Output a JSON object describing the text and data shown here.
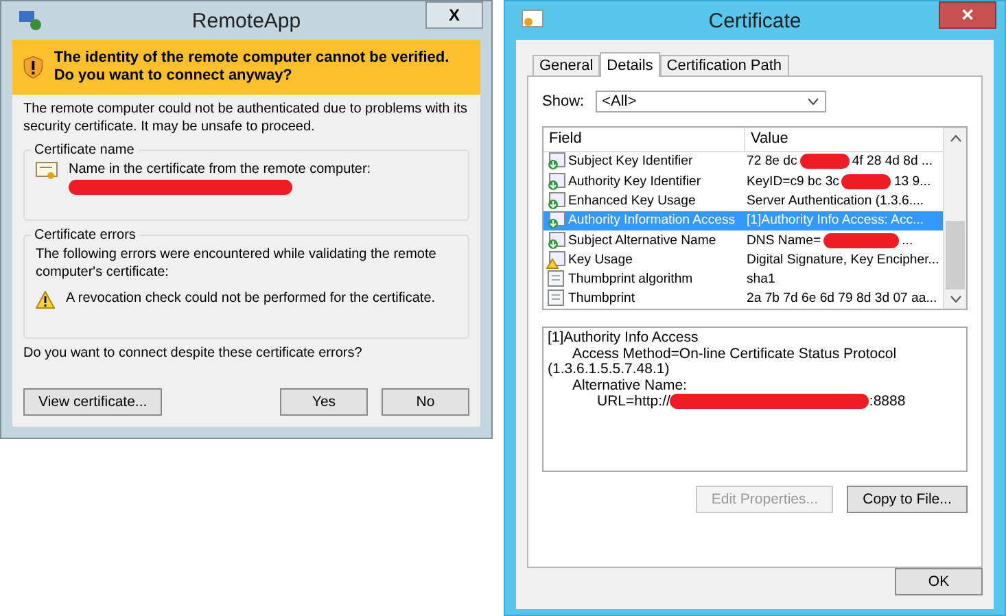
{
  "remoteapp": {
    "title": "RemoteApp",
    "close": "X",
    "warning": "The identity of the remote computer cannot be verified. Do you want to connect anyway?",
    "intro": "The remote computer could not be authenticated due to problems with its security certificate. It may be unsafe to proceed.",
    "cert_name_group": {
      "legend": "Certificate name",
      "label": "Name in the certificate from the remote computer:"
    },
    "cert_errors_group": {
      "legend": "Certificate errors",
      "text": "The following errors were encountered while validating the remote computer's certificate:",
      "errors": [
        "A revocation check could not be performed for the certificate."
      ]
    },
    "question": "Do you want to connect despite these certificate errors?",
    "buttons": [
      {
        "label": "View certificate...",
        "kind": "left"
      },
      {
        "label": "Yes",
        "kind": "right"
      },
      {
        "label": "No",
        "kind": "right"
      }
    ]
  },
  "certificate": {
    "title": "Certificate",
    "close": "✕",
    "tabs": [
      {
        "label": "General",
        "selected": false
      },
      {
        "label": "Details",
        "selected": true
      },
      {
        "label": "Certification Path",
        "selected": false
      }
    ],
    "show": {
      "label": "Show:",
      "value": "<All>"
    },
    "columns": [
      "Field",
      "Value"
    ],
    "rows": [
      {
        "field": "Subject Key Identifier",
        "value_parts": [
          "72 8e dc",
          "4f 28 4d 8d ..."
        ],
        "kind": "extension",
        "selected": false
      },
      {
        "field": "Authority Key Identifier",
        "value_parts": [
          "KeyID=c9 bc 3c",
          "13 9..."
        ],
        "kind": "extension",
        "selected": false
      },
      {
        "field": "Enhanced Key Usage",
        "value_parts": [
          "Server Authentication (1.3.6...."
        ],
        "kind": "extension",
        "selected": false
      },
      {
        "field": "Authority Information Access",
        "value_parts": [
          "[1]Authority Info Access: Acc..."
        ],
        "kind": "extension",
        "selected": true
      },
      {
        "field": "Subject Alternative Name",
        "value_parts": [
          "DNS Name=",
          "..."
        ],
        "kind": "extension",
        "selected": false
      },
      {
        "field": "Key Usage",
        "value_parts": [
          "Digital Signature, Key Encipher..."
        ],
        "kind": "critical",
        "selected": false
      },
      {
        "field": "Thumbprint algorithm",
        "value_parts": [
          "sha1"
        ],
        "kind": "property",
        "selected": false
      },
      {
        "field": "Thumbprint",
        "value_parts": [
          "2a 7b 7d 6e 6d 79 8d 3d 07 aa..."
        ],
        "kind": "property",
        "selected": false
      }
    ],
    "detail_lines": [
      {
        "parts": [
          "[1]Authority Info Access"
        ],
        "children": [
          {
            "parts": [
              "Access Method=On-line Certificate Status Protocol (1.3.6.1.5.5.7.48.1)"
            ]
          },
          {
            "parts": [
              "Alternative Name:"
            ],
            "children": [
              {
                "parts": [
                  "URL=http://",
                  ":8888"
                ]
              }
            ]
          }
        ]
      }
    ],
    "buttons": [
      {
        "label": "Edit Properties...",
        "disabled": true
      },
      {
        "label": "Copy to File...",
        "disabled": false
      }
    ],
    "ok": "OK"
  }
}
